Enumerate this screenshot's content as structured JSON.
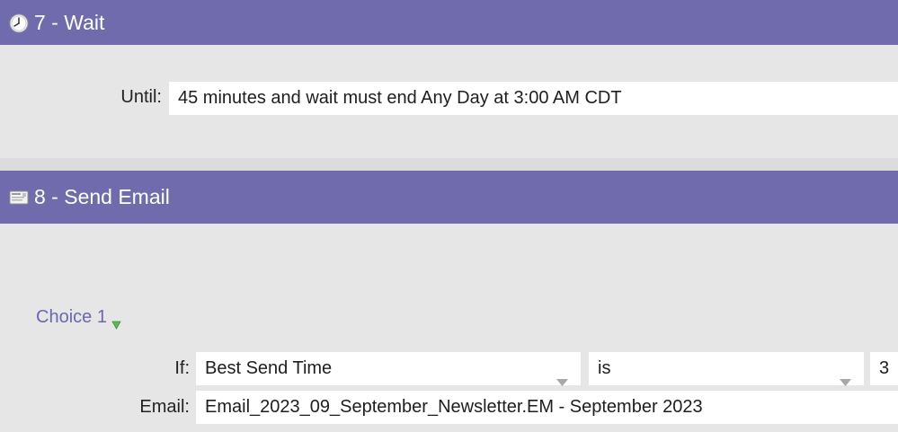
{
  "steps": [
    {
      "title": "7 - Wait",
      "icon": "clock-icon",
      "until_label": "Until:",
      "until_value": "45 minutes and wait must end Any Day at 3:00 AM CDT"
    },
    {
      "title": "8 - Send Email",
      "icon": "envelope-icon",
      "choice_label": "Choice 1",
      "if_label": "If:",
      "if_field": "Best Send Time",
      "operator": "is",
      "value": "3",
      "email_label": "Email:",
      "email_value": "Email_2023_09_September_Newsletter.EM - September 2023"
    }
  ],
  "colors": {
    "header": "#6f6bad",
    "panel": "#e6e6e6",
    "link": "#6a68b0",
    "choice_arrow": "#5cb85c"
  }
}
